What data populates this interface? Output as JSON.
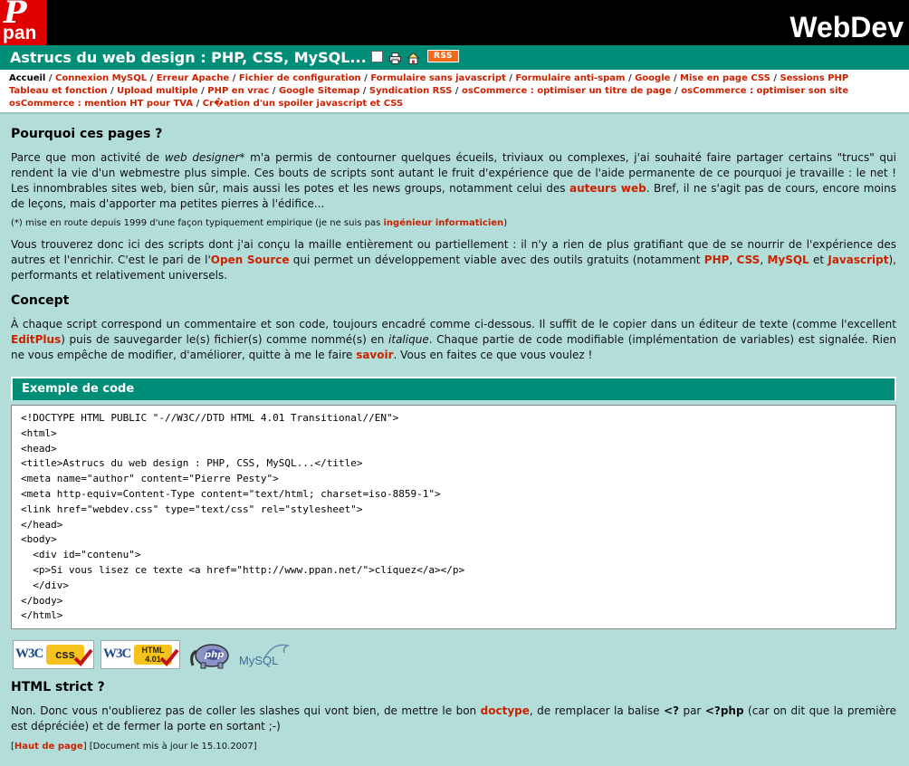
{
  "header": {
    "logo_p": "P",
    "logo_text": "pan",
    "brand": "WebDev"
  },
  "titlebar": {
    "title": "Astrucs du web design : PHP, CSS, MySQL...",
    "rss_label": "RSS"
  },
  "nav": {
    "current": "Accueil",
    "items": [
      "Connexion MySQL",
      "Erreur Apache",
      "Fichier de configuration",
      "Formulaire sans javascript",
      "Formulaire anti-spam",
      "Google",
      "Mise en page CSS",
      "Sessions PHP",
      "Tableau et fonction",
      "Upload multiple",
      "PHP en vrac",
      "Google Sitemap",
      "Syndication RSS",
      "osCommerce : optimiser un titre de page",
      "osCommerce : optimiser son site",
      "osCommerce : mention HT pour TVA",
      "Cr�ation d'un spoiler javascript et CSS"
    ]
  },
  "section1": {
    "heading": "Pourquoi ces pages ?",
    "p1_a": "Parce que mon activité de ",
    "p1_em": "web designer*",
    "p1_b": " m'a permis de contourner quelques écueils, triviaux ou complexes, j'ai souhaité faire partager certains \"trucs\" qui rendent la vie d'un webmestre plus simple. Ces bouts de scripts sont autant le fruit d'expérience que de l'aide permanente de ce pourquoi je travaille : le net ! Les innombrables sites web, bien sûr, mais aussi les potes et les news groups, notamment celui des ",
    "p1_link": "auteurs web",
    "p1_c": ". Bref, il ne s'agit pas de cours, encore moins de leçons, mais d'apporter ma petites pierres à l'édifice...",
    "note_a": "(*) mise en route depuis 1999 d'une façon typiquement empirique (je ne suis pas ",
    "note_link": "ingénieur informaticien",
    "note_b": ")",
    "p2_a": "Vous trouverez donc ici des scripts dont j'ai conçu la maille entièrement ou partiellement : il n'y a rien de plus gratifiant que de se nourrir de l'expérience des autres et l'enrichir. C'est le pari de l'",
    "p2_link": "Open Source",
    "p2_b": " qui permet un développement viable avec des outils gratuits (notamment ",
    "p2_php": "PHP",
    "p2_sep1": ", ",
    "p2_css": "CSS",
    "p2_sep2": ", ",
    "p2_mysql": "MySQL",
    "p2_et": " et ",
    "p2_js": "Javascript",
    "p2_c": "), performants et relativement universels."
  },
  "section2": {
    "heading": "Concept",
    "p_a": "À chaque script correspond un commentaire et son code, toujours encadré comme ci-dessous. Il suffit de le copier dans un éditeur de texte (comme l'excellent ",
    "p_link": "EditPlus",
    "p_b": ") puis de sauvegarder le(s) fichier(s) comme nommé(s) en ",
    "p_em": "italique",
    "p_c": ". Chaque partie de code modifiable (implémentation de variables) est signalée. Rien ne vous empêche de modifier, d'améliorer, quitte à me le faire ",
    "p_link2": "savoir",
    "p_d": ". Vous en faites ce que vous voulez !"
  },
  "code": {
    "title": "Exemple de code",
    "lines": [
      "<!DOCTYPE HTML PUBLIC \"-//W3C//DTD HTML 4.01 Transitional//EN\">",
      "<html>",
      "<head>",
      "<title>Astrucs du web design : PHP, CSS, MySQL...</title>",
      "<meta name=\"author\" content=\"Pierre Pesty\">",
      "<meta http-equiv=Content-Type content=\"text/html; charset=iso-8859-1\">",
      "<link href=\"webdev.css\" type=\"text/css\" rel=\"stylesheet\">",
      "</head>",
      "<body>",
      "  <div id=\"contenu\">",
      "  <p>Si vous lisez ce texte <a href=\"http://www.ppan.net/\">cliquez</a></p>",
      "  </div>",
      "</body>",
      "</html>"
    ]
  },
  "badges": {
    "w3c": "W3C",
    "css": "css",
    "html_top": "HTML",
    "html_bottom": "4.01",
    "php": "php",
    "mysql": "MySQL"
  },
  "section3": {
    "heading": "HTML strict ?",
    "p_a": "Non. Donc vous n'oublierez pas de coller les slashes qui vont bien, de mettre le bon ",
    "p_link": "doctype",
    "p_b": ", de remplacer la balise ",
    "p_tag1": "<?",
    "p_c": " par ",
    "p_tag2": "<?php",
    "p_d": " (car on dit que la première est dépréciée) et de fermer la porte en sortant ;-)"
  },
  "footer": {
    "open": "[",
    "top_link": "Haut de page",
    "close": "]",
    "updated": " [Document mis à jour le 15.10.2007]"
  },
  "colors": {
    "teal": "#008e78",
    "background": "#b2ddd8",
    "link": "#cc2200",
    "logo_red": "#e00000",
    "rss_orange": "#f26a1b"
  }
}
